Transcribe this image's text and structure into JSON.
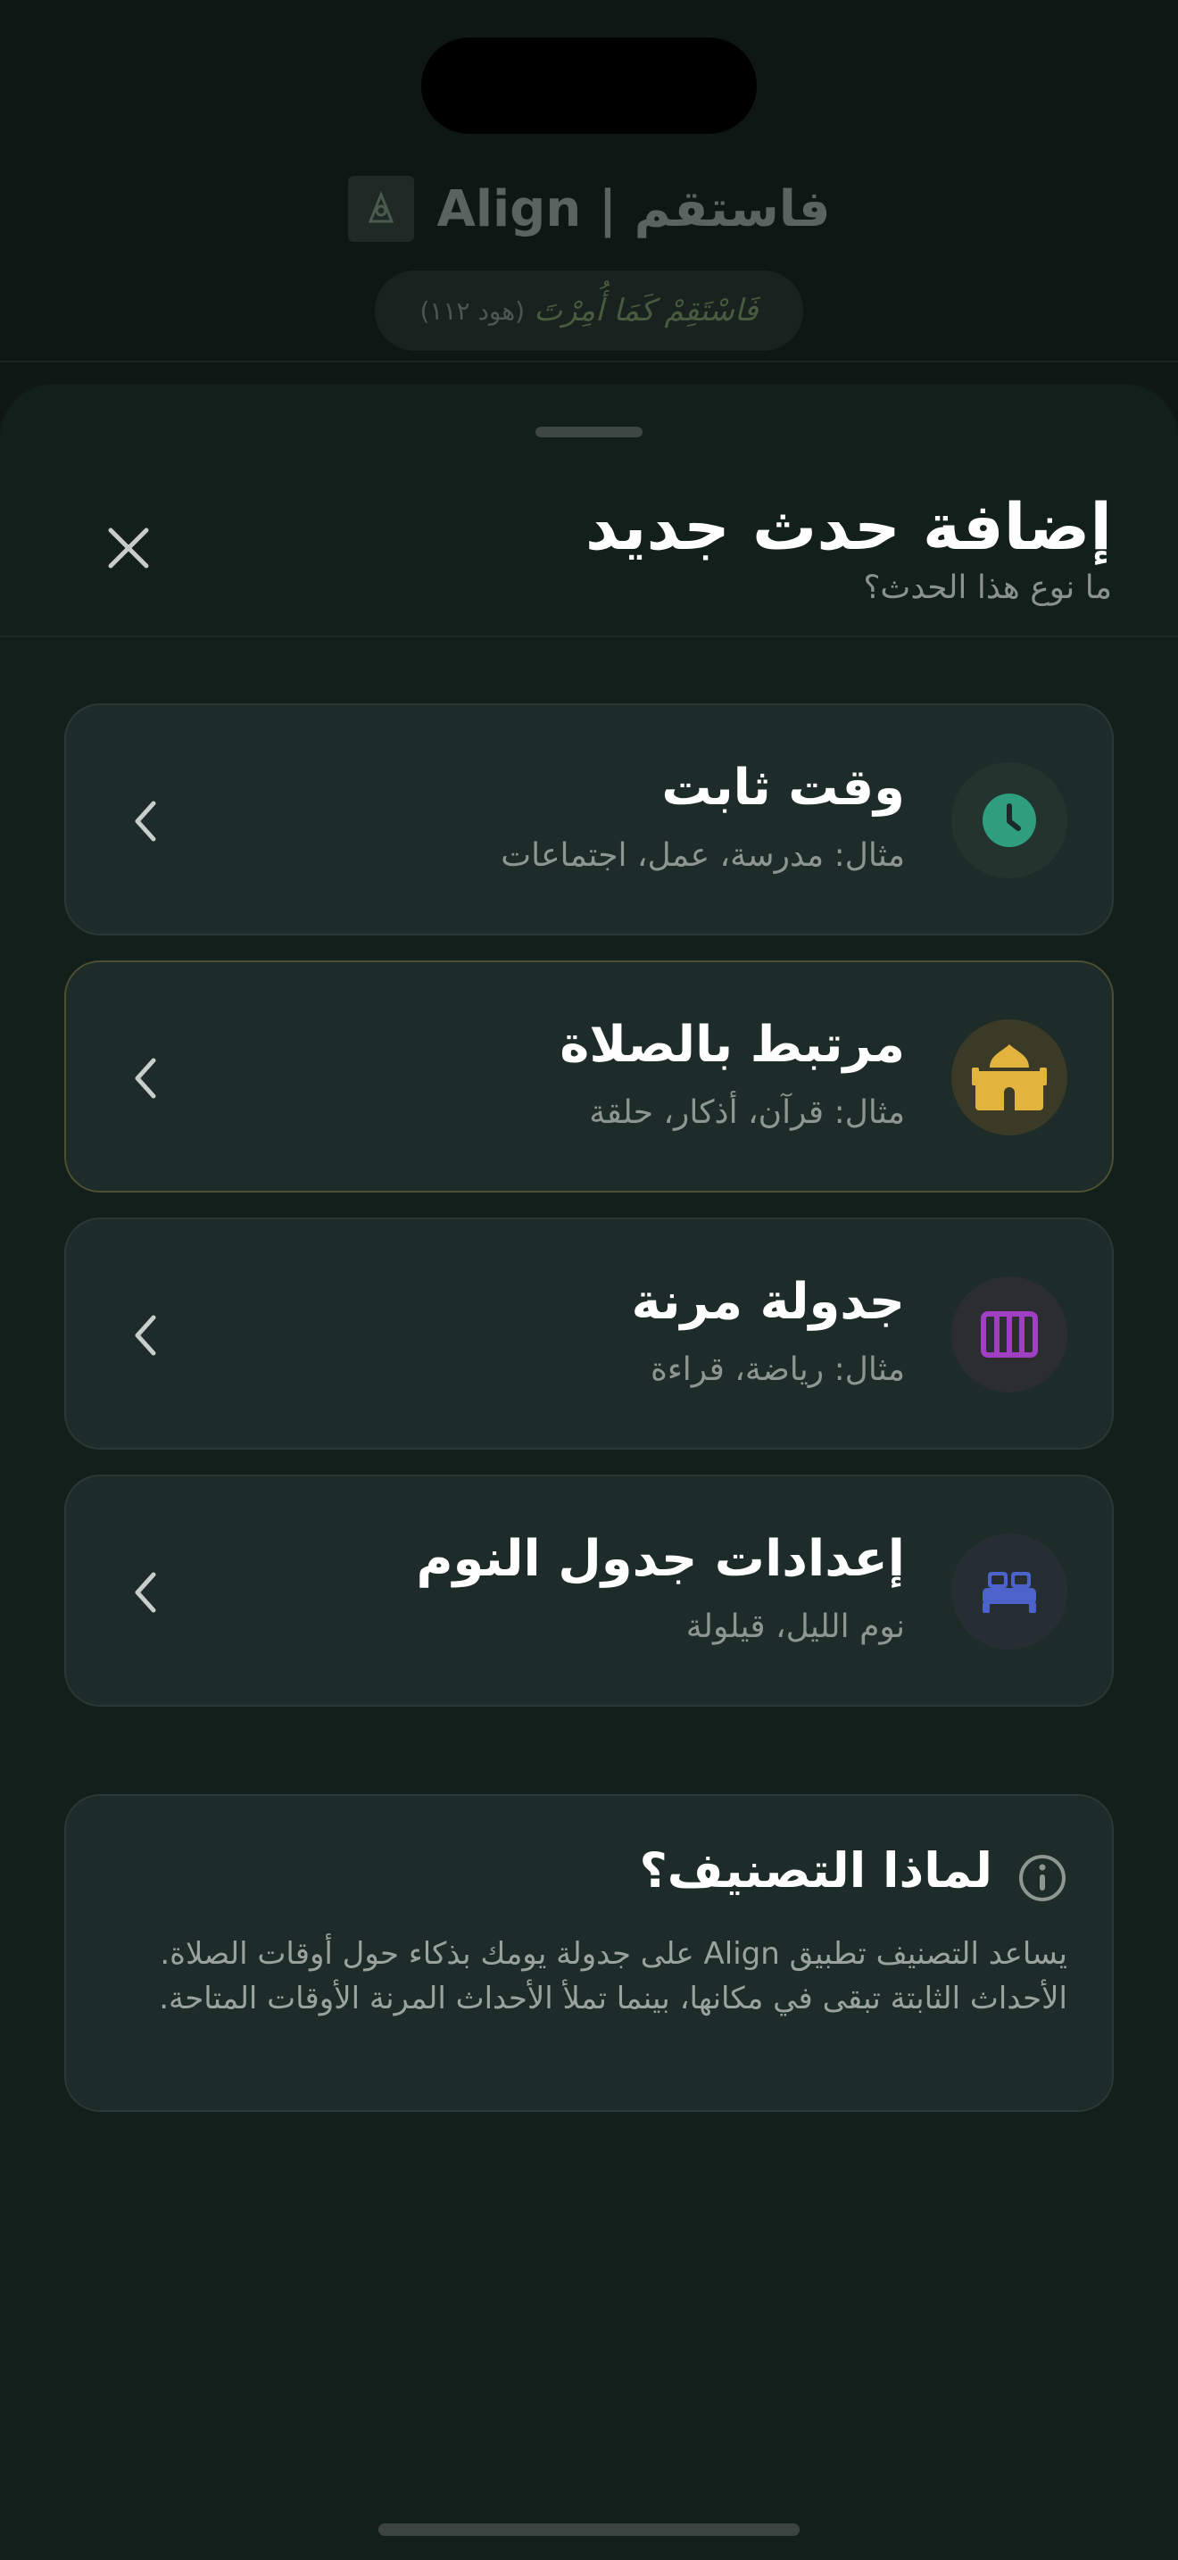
{
  "app": {
    "title": "فاستقم | Align",
    "verse_text": "فَاسْتَقِمْ كَمَا أُمِرْتَ",
    "verse_ref": "(هود ١١٢)"
  },
  "sheet": {
    "title": "إضافة حدث جديد",
    "subtitle": "ما نوع هذا الحدث؟",
    "close_icon": "close-icon"
  },
  "options": [
    {
      "title": "وقت ثابت",
      "subtitle": "مثال: مدرسة، عمل، اجتماعات",
      "icon": "clock-icon",
      "icon_color": "#2f9e7f",
      "icon_bg": "#23342f",
      "highlighted": false
    },
    {
      "title": "مرتبط بالصلاة",
      "subtitle": "مثال: قرآن، أذكار، حلقة",
      "icon": "mosque-icon",
      "icon_color": "#e2b43d",
      "icon_bg": "#3a3a26",
      "highlighted": true
    },
    {
      "title": "جدولة مرنة",
      "subtitle": "مثال: رياضة، قراءة",
      "icon": "columns-icon",
      "icon_color": "#a03fc2",
      "icon_bg": "#2b2d31",
      "highlighted": false
    },
    {
      "title": "إعدادات جدول النوم",
      "subtitle": "نوم الليل، قيلولة",
      "icon": "bed-icon",
      "icon_color": "#4c63c9",
      "icon_bg": "#262e33",
      "highlighted": false
    }
  ],
  "info": {
    "title": "لماذا التصنيف؟",
    "body": "يساعد التصنيف تطبيق Align على جدولة يومك بذكاء حول أوقات الصلاة. الأحداث الثابتة تبقى في مكانها، بينما تملأ الأحداث المرنة الأوقات المتاحة.",
    "icon": "info-icon"
  },
  "colors": {
    "background": "#0f1815",
    "sheet": "#121f1b",
    "card": "#1d2c28",
    "card_border": "#2a3935",
    "highlight_border": "#4d4f30"
  }
}
